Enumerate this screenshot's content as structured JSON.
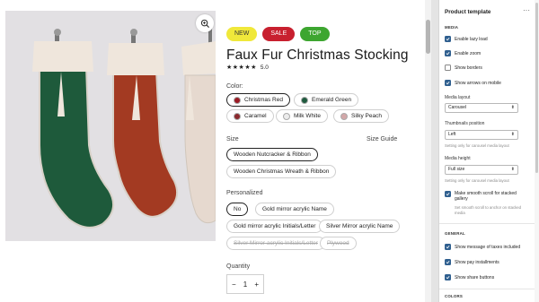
{
  "product": {
    "badges": [
      "NEW",
      "SALE",
      "TOP"
    ],
    "title": "Faux Fur Christmas Stocking",
    "stars": "★★★★★",
    "rating": "5.0",
    "color_label": "Color:",
    "colors": [
      {
        "label": "Christmas Red",
        "swatch": "#9b1a24",
        "selected": true
      },
      {
        "label": "Emerald Green",
        "swatch": "#1f5a3e",
        "selected": false
      },
      {
        "label": "Caramel",
        "swatch": "#8b2a2e",
        "selected": false
      },
      {
        "label": "Milk White",
        "swatch": "#ececec",
        "selected": false
      },
      {
        "label": "Silky Peach",
        "swatch": "#d2a7a8",
        "selected": false
      }
    ],
    "size_label": "Size",
    "size_guide": "Size Guide",
    "sizes": [
      {
        "label": "Wooden Nutcracker & Ribbon",
        "selected": true
      },
      {
        "label": "Wooden Christmas Wreath & Ribbon",
        "selected": false
      }
    ],
    "personalized_label": "Personalized",
    "personalized": [
      {
        "label": "No",
        "selected": true,
        "disabled": false
      },
      {
        "label": "Gold mirror acrylic Name",
        "selected": false,
        "disabled": false
      },
      {
        "label": "Gold mirror acrylic Initials/Letter",
        "selected": false,
        "disabled": false
      },
      {
        "label": "Silver Mirror acrylic Name",
        "selected": false,
        "disabled": false
      },
      {
        "label": "Silver Mirror acrylic Initials/Letter",
        "selected": false,
        "disabled": true
      },
      {
        "label": "Plywood",
        "selected": false,
        "disabled": true
      }
    ],
    "quantity_label": "Quantity",
    "quantity": "1",
    "minus": "−",
    "plus": "+"
  },
  "gallery": {
    "icons": {
      "zoom": "zoom-in-icon",
      "up": "chevron-up-icon",
      "down": "chevron-down-icon"
    },
    "stocking_colors": [
      "#1e5a3b",
      "#a33a22",
      "#e6d9cf"
    ]
  },
  "panel": {
    "title": "Product template",
    "more": "···",
    "media_section": "MEDIA",
    "lazy_load": "Enable lazy load",
    "zoom": "Enable zoom",
    "show_borders": "Show borders",
    "show_arrows": "Show arrows on mobile",
    "media_layout_label": "Media layout",
    "media_layout_value": "Carousel",
    "thumbs_position_label": "Thumbnails position",
    "thumbs_position_value": "Left",
    "thumbs_note": "Setting only for carousel media layout",
    "media_height_label": "Media height",
    "media_height_value": "Full size",
    "media_height_note": "Setting only for carousel media layout",
    "smooth_scroll": "Make smooth scroll for stacked gallery",
    "smooth_scroll_note": "Set smooth scroll to anchor on stacked media",
    "general_section": "GENERAL",
    "taxes_msg": "Show message of taxes included",
    "pay_installments": "Show pay installments",
    "share_buttons": "Show share buttons",
    "colors_section": "COLORS",
    "accent": "#2f5f8f"
  }
}
